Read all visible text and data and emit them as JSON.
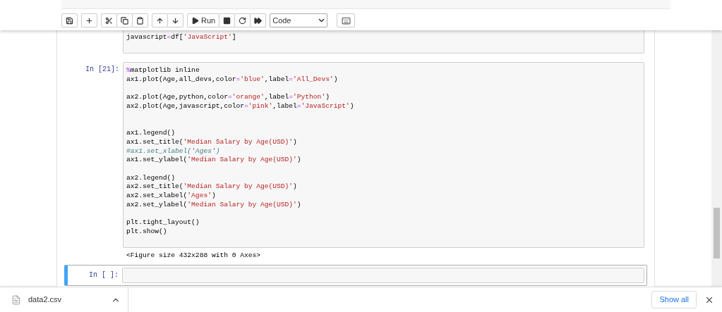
{
  "toolbar": {
    "buttons": [
      {
        "kind": "save"
      },
      {
        "kind": "add"
      },
      {
        "kind": "cut"
      },
      {
        "kind": "copy"
      },
      {
        "kind": "paste"
      },
      {
        "kind": "up"
      },
      {
        "kind": "down"
      },
      {
        "kind": "run",
        "label": "Run"
      },
      {
        "kind": "stop"
      },
      {
        "kind": "restart"
      },
      {
        "kind": "fast-forward"
      }
    ],
    "cell_type": "Code"
  },
  "cells": [
    {
      "selected": false,
      "lines": [
        {
          "kind": "code",
          "segments": [
            {
              "kind": "text",
              "text": "javascript"
            },
            {
              "kind": "op",
              "text": "="
            },
            {
              "kind": "text",
              "text": "df["
            },
            {
              "kind": "str",
              "text": "'JavaScript'"
            },
            {
              "kind": "text",
              "text": "]"
            }
          ]
        },
        {
          "kind": "blank"
        }
      ]
    },
    {
      "selected": false,
      "prompt": "In [21]:",
      "lines": [
        {
          "kind": "code",
          "segments": [
            {
              "kind": "op",
              "text": "%"
            },
            {
              "kind": "text",
              "text": "matplotlib inline"
            }
          ]
        },
        {
          "kind": "code",
          "segments": [
            {
              "kind": "text",
              "text": "ax1.plot(Age,all_devs,color"
            },
            {
              "kind": "op",
              "text": "="
            },
            {
              "kind": "str",
              "text": "'blue'"
            },
            {
              "kind": "text",
              "text": ",label"
            },
            {
              "kind": "op",
              "text": "="
            },
            {
              "kind": "str",
              "text": "'All_Devs'"
            },
            {
              "kind": "text",
              "text": ")"
            }
          ]
        },
        {
          "kind": "blank"
        },
        {
          "kind": "code",
          "segments": [
            {
              "kind": "text",
              "text": "ax2.plot(Age,python,color"
            },
            {
              "kind": "op",
              "text": "="
            },
            {
              "kind": "str",
              "text": "'orange'"
            },
            {
              "kind": "text",
              "text": ",label"
            },
            {
              "kind": "op",
              "text": "="
            },
            {
              "kind": "str",
              "text": "'Python'"
            },
            {
              "kind": "text",
              "text": ")"
            }
          ]
        },
        {
          "kind": "code",
          "segments": [
            {
              "kind": "text",
              "text": "ax2.plot(Age,javascript,color"
            },
            {
              "kind": "op",
              "text": "="
            },
            {
              "kind": "str",
              "text": "'pink'"
            },
            {
              "kind": "text",
              "text": ",label"
            },
            {
              "kind": "op",
              "text": "="
            },
            {
              "kind": "str",
              "text": "'JavaScript'"
            },
            {
              "kind": "text",
              "text": ")"
            }
          ]
        },
        {
          "kind": "blank"
        },
        {
          "kind": "blank"
        },
        {
          "kind": "code",
          "segments": [
            {
              "kind": "text",
              "text": "ax1.legend()"
            }
          ]
        },
        {
          "kind": "code",
          "segments": [
            {
              "kind": "text",
              "text": "ax1.set_title("
            },
            {
              "kind": "str",
              "text": "'Median Salary by Age(USD)'"
            },
            {
              "kind": "text",
              "text": ")"
            }
          ]
        },
        {
          "kind": "code",
          "segments": [
            {
              "kind": "comment",
              "text": "#ax1.set_xlabel('Ages')"
            }
          ]
        },
        {
          "kind": "code",
          "segments": [
            {
              "kind": "text",
              "text": "ax1.set_ylabel("
            },
            {
              "kind": "str",
              "text": "'Median Salary by Age(USD)'"
            },
            {
              "kind": "text",
              "text": ")"
            }
          ]
        },
        {
          "kind": "blank"
        },
        {
          "kind": "code",
          "segments": [
            {
              "kind": "text",
              "text": "ax2.legend()"
            }
          ]
        },
        {
          "kind": "code",
          "segments": [
            {
              "kind": "text",
              "text": "ax2.set_title("
            },
            {
              "kind": "str",
              "text": "'Median Salary by Age(USD)'"
            },
            {
              "kind": "text",
              "text": ")"
            }
          ]
        },
        {
          "kind": "code",
          "segments": [
            {
              "kind": "text",
              "text": "ax2.set_xlabel("
            },
            {
              "kind": "str",
              "text": "'Ages'"
            },
            {
              "kind": "text",
              "text": ")"
            }
          ]
        },
        {
          "kind": "code",
          "segments": [
            {
              "kind": "text",
              "text": "ax2.set_ylabel("
            },
            {
              "kind": "str",
              "text": "'Median Salary by Age(USD)'"
            },
            {
              "kind": "text",
              "text": ")"
            }
          ]
        },
        {
          "kind": "blank"
        },
        {
          "kind": "code",
          "segments": [
            {
              "kind": "text",
              "text": "plt.tight_layout()"
            }
          ]
        },
        {
          "kind": "code",
          "segments": [
            {
              "kind": "text",
              "text": "plt.show()"
            }
          ]
        },
        {
          "kind": "blank"
        }
      ],
      "output": "<Figure size 432x288 with 0 Axes>"
    },
    {
      "selected": true,
      "prompt": "In [ ]:"
    }
  ],
  "downloads": {
    "file": "data2.csv",
    "show_all": "Show all"
  }
}
